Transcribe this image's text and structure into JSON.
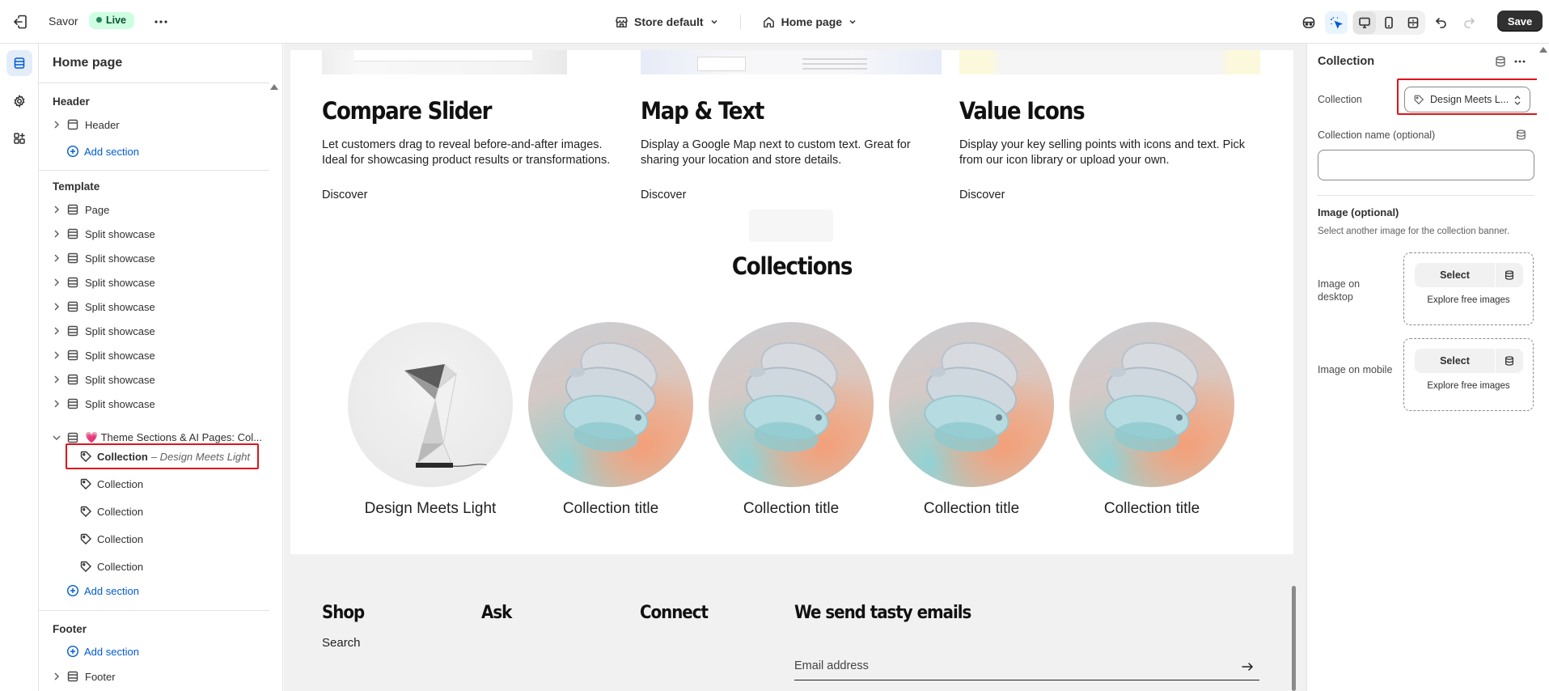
{
  "topbar": {
    "store_name": "Savor",
    "live_badge": "Live",
    "theme_selector": "Store default",
    "page_selector": "Home page",
    "save_label": "Save"
  },
  "left_panel": {
    "title": "Home page",
    "header_group": "Header",
    "header_item": "Header",
    "add_section": "Add section",
    "template_group": "Template",
    "template_items": [
      "Page",
      "Split showcase",
      "Split showcase",
      "Split showcase",
      "Split showcase",
      "Split showcase",
      "Split showcase",
      "Split showcase",
      "Split showcase"
    ],
    "theme_section": "💗 Theme Sections & AI Pages: Col...",
    "collection_selected_label": "Collection",
    "collection_selected_detail": "– Design Meets Light",
    "collection_children": [
      "Collection",
      "Collection",
      "Collection",
      "Collection"
    ],
    "footer_group": "Footer",
    "footer_item": "Footer"
  },
  "preview": {
    "columns": [
      {
        "title": "Compare Slider",
        "text": "Let customers drag to reveal before-and-after images. Ideal for showcasing product results or transformations.",
        "link": "Discover"
      },
      {
        "title": "Map & Text",
        "text": "Display a Google Map next to custom text. Great for sharing your location and store details.",
        "link": "Discover"
      },
      {
        "title": "Value Icons",
        "text": "Display your key selling points with icons and text. Pick from our icon library or upload your own.",
        "link": "Discover"
      }
    ],
    "collections_heading": "Collections",
    "collections": [
      "Design Meets Light",
      "Collection title",
      "Collection title",
      "Collection title",
      "Collection title"
    ],
    "footer": {
      "shop": "Shop",
      "ask": "Ask",
      "connect": "Connect",
      "newsletter": "We send tasty emails",
      "search_link": "Search",
      "email_placeholder": "Email address"
    }
  },
  "right_panel": {
    "title": "Collection",
    "collection_label": "Collection",
    "collection_value": "Design Meets L...",
    "collection_name_label": "Collection name (optional)",
    "image_heading": "Image (optional)",
    "image_desc": "Select another image for the collection banner.",
    "image_desktop_label": "Image on desktop",
    "image_mobile_label": "Image on mobile",
    "select_label": "Select",
    "explore_label": "Explore free images"
  },
  "colors": {
    "accent": "#005bd3",
    "live_bg": "#cdfee1",
    "highlight": "#e0131b",
    "save_bg": "#303030"
  }
}
